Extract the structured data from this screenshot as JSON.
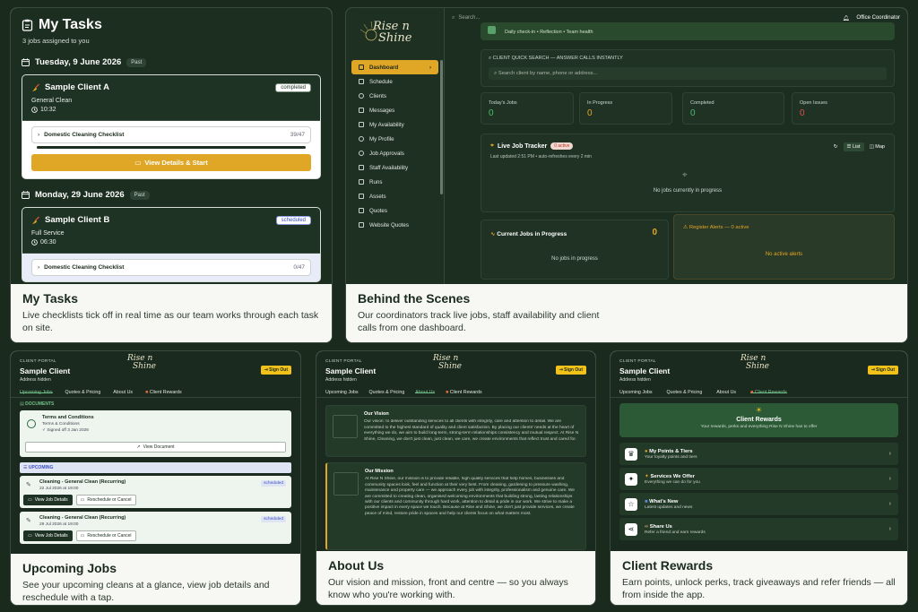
{
  "cards": {
    "my_tasks": {
      "caption_title": "My Tasks",
      "caption_text": "Live checklists tick off in real time as our team works through each task on site.",
      "title": "My Tasks",
      "subtitle": "3 jobs assigned to you",
      "day1": {
        "date": "Tuesday, 9 June 2026",
        "badge": "Past"
      },
      "job1": {
        "client": "Sample Client A",
        "service": "General Clean",
        "time": "10:32",
        "status": "completed",
        "checklist": "Domestic Cleaning Checklist",
        "progress": "39/47",
        "button": "View Details & Start"
      },
      "day2": {
        "date": "Monday, 29 June 2026",
        "badge": "Past"
      },
      "job2": {
        "client": "Sample Client B",
        "service": "Full Service",
        "time": "06:30",
        "status": "scheduled",
        "checklist": "Domestic Cleaning Checklist",
        "progress": "0/47"
      }
    },
    "behind": {
      "caption_title": "Behind the Scenes",
      "caption_text": "Our coordinators track live jobs, staff availability and client calls from one dashboard.",
      "search_placeholder": "Search...",
      "role": "Office Coordinator",
      "nav": [
        "Dashboard",
        "Schedule",
        "Clients",
        "Messages",
        "My Availability",
        "My Profile",
        "Job Approvals",
        "Staff Availability",
        "Runs",
        "Assets",
        "Quotes",
        "Website Quotes"
      ],
      "checkin_text": "Daily check-in • Reflection • Team health",
      "quick_search_label": "CLIENT QUICK SEARCH — ANSWER CALLS INSTANTLY",
      "quick_search_placeholder": "Search client by name, phone or address...",
      "stats": [
        {
          "label": "Today's Jobs",
          "value": "0",
          "color": "#4cc06a"
        },
        {
          "label": "In Progress",
          "value": "0",
          "color": "#e0a625"
        },
        {
          "label": "Completed",
          "value": "0",
          "color": "#4cc06a"
        },
        {
          "label": "Open Issues",
          "value": "0",
          "color": "#e05050"
        }
      ],
      "tracker_title": "Live Job Tracker",
      "tracker_badge": "0 active",
      "tracker_updated": "Last updated 2:51 PM • auto-refreshes every 2 min",
      "tracker_list": "List",
      "tracker_map": "Map",
      "tracker_empty": "No jobs currently in progress",
      "current_title": "Current Jobs in Progress",
      "current_count": "0",
      "current_empty": "No jobs in progress",
      "alerts_title": "Register Alerts — 0 active",
      "alerts_empty": "No active alerts"
    },
    "upcoming": {
      "caption_title": "Upcoming Jobs",
      "caption_text": "See your upcoming cleans at a glance, view job details and reschedule with a tap.",
      "portal": "CLIENT PORTAL",
      "client": "Sample Client",
      "address": "Address hidden",
      "signout": "Sign Out",
      "tabs": [
        "Upcoming Jobs",
        "Quotes & Pricing",
        "About Us",
        "Client Rewards"
      ],
      "documents_label": "DOCUMENTS",
      "doc_title": "Terms and Conditions",
      "doc_sub": "Terms & Conditions",
      "doc_signed": "Signed off 3 Jan 2026",
      "doc_button": "View Document",
      "upcoming_label": "UPCOMING",
      "jobs": [
        {
          "title": "Cleaning - General Clean (Recurring)",
          "date": "22 Jul 2026 at 19:00",
          "status": "scheduled",
          "btn1": "View Job Details",
          "btn2": "Reschedule or Cancel"
        },
        {
          "title": "Cleaning - General Clean (Recurring)",
          "date": "29 Jul 2026 at 19:00",
          "status": "scheduled",
          "btn1": "View Job Details",
          "btn2": "Reschedule or Cancel"
        }
      ]
    },
    "about": {
      "caption_title": "About Us",
      "caption_text": "Our vision and mission, front and centre — so you always know who you're working with.",
      "portal": "CLIENT PORTAL",
      "client": "Sample Client",
      "address": "Address hidden",
      "signout": "Sign Out",
      "tabs": [
        "Upcoming Jobs",
        "Quotes & Pricing",
        "About Us",
        "Client Rewards"
      ],
      "vision_title": "Our Vision",
      "vision_text": "Our vision: to deliver outstanding services to all clients with integrity, care and attention to detail. We are committed to the highest standard of quality and client satisfaction. By placing our clients' needs at the heart of everything we do, we aim to build long-term, strong-term relationships consistency and mutual respect. At Rise N Shine, Cleaning, we don't just clean, just clean, we care, we create environments that reflect trust and cared for.",
      "mission_title": "Our Mission",
      "mission_text": "At Rise N Shine, our mission is to provide reliable, high quality services that help homes, businesses and community spaces look, feel and function at their very best. From cleaning, gardening to pressure washing, maintenance and property care — we approach every job with integrity, professionalism and genuine care. We are committed to creating clean, organised welcoming environments that building strong, lasting relationships with our clients and community through hard work, attention to detail & pride in our work. We strive to make a positive impact in every space we touch. Because at Rise and Shine, we don't just provide services, we create peace of mind, restore pride in spaces and help our clients focus on what matters most."
    },
    "rewards": {
      "caption_title": "Client Rewards",
      "caption_text": "Earn points, unlock perks, track giveaways and refer friends — all from inside the app.",
      "portal": "CLIENT PORTAL",
      "client": "Sample Client",
      "address": "Address hidden",
      "signout": "Sign Out",
      "tabs": [
        "Upcoming Jobs",
        "Quotes & Pricing",
        "About Us",
        "Client Rewards"
      ],
      "hero_title": "Client Rewards",
      "hero_sub": "Your rewards, perks and everything Rise N Shine has to offer",
      "items": [
        {
          "title": "My Points & Tiers",
          "sub": "Your loyalty points and tiers"
        },
        {
          "title": "Services We Offer",
          "sub": "Everything we can do for you"
        },
        {
          "title": "What's New",
          "sub": "Latest updates and news"
        },
        {
          "title": "Share Us",
          "sub": "Refer a friend and earn rewards"
        }
      ]
    }
  },
  "logo": {
    "line1": "Rise n",
    "line2": "Shine"
  },
  "colors": {
    "bg": "#1a2a1d",
    "panel": "#1c2e20",
    "accent": "#e0a625",
    "green": "#73c08a"
  }
}
